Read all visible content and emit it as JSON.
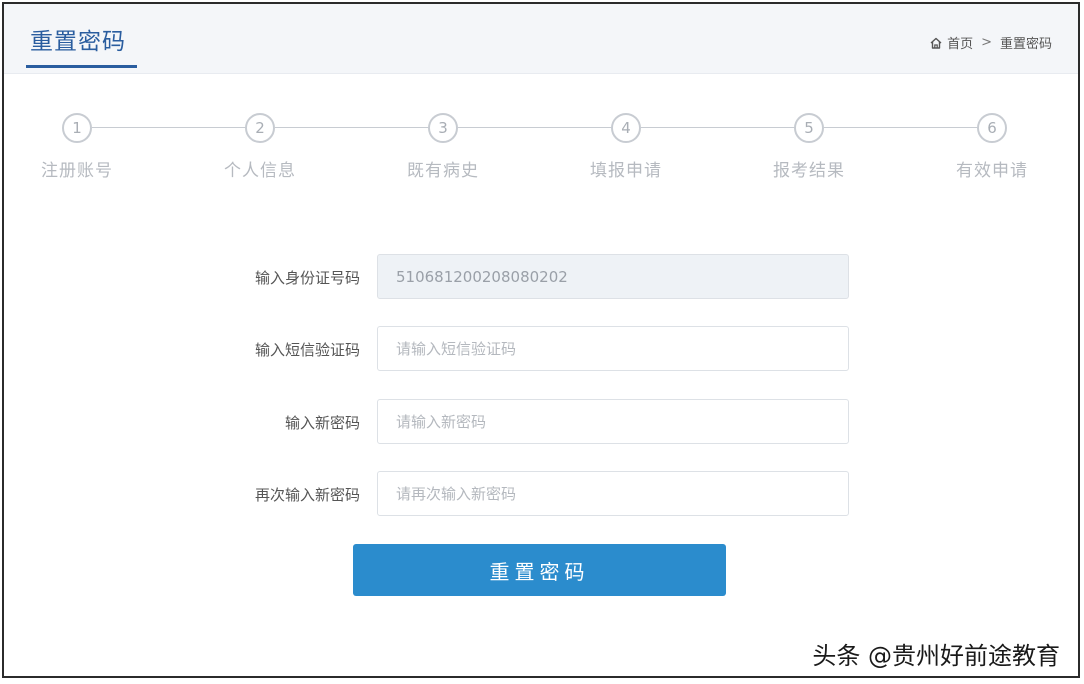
{
  "header": {
    "title": "重置密码",
    "breadcrumb": {
      "home": "首页",
      "separator": ">",
      "current": "重置密码"
    }
  },
  "steps": [
    {
      "number": "1",
      "label": "注册账号"
    },
    {
      "number": "2",
      "label": "个人信息"
    },
    {
      "number": "3",
      "label": "既有病史"
    },
    {
      "number": "4",
      "label": "填报申请"
    },
    {
      "number": "5",
      "label": "报考结果"
    },
    {
      "number": "6",
      "label": "有效申请"
    }
  ],
  "form": {
    "id_number": {
      "label": "输入身份证号码",
      "value": "510681200208080202"
    },
    "sms_code": {
      "label": "输入短信验证码",
      "placeholder": "请输入短信验证码"
    },
    "new_password": {
      "label": "输入新密码",
      "placeholder": "请输入新密码"
    },
    "confirm_password": {
      "label": "再次输入新密码",
      "placeholder": "请再次输入新密码"
    },
    "submit_label": "重置密码"
  },
  "watermark": "头条 @贵州好前途教育",
  "colors": {
    "accent": "#2a5d9f",
    "button": "#2b8ccd",
    "step_inactive": "#c8ccd2"
  },
  "icons": {
    "home": "home-icon"
  }
}
